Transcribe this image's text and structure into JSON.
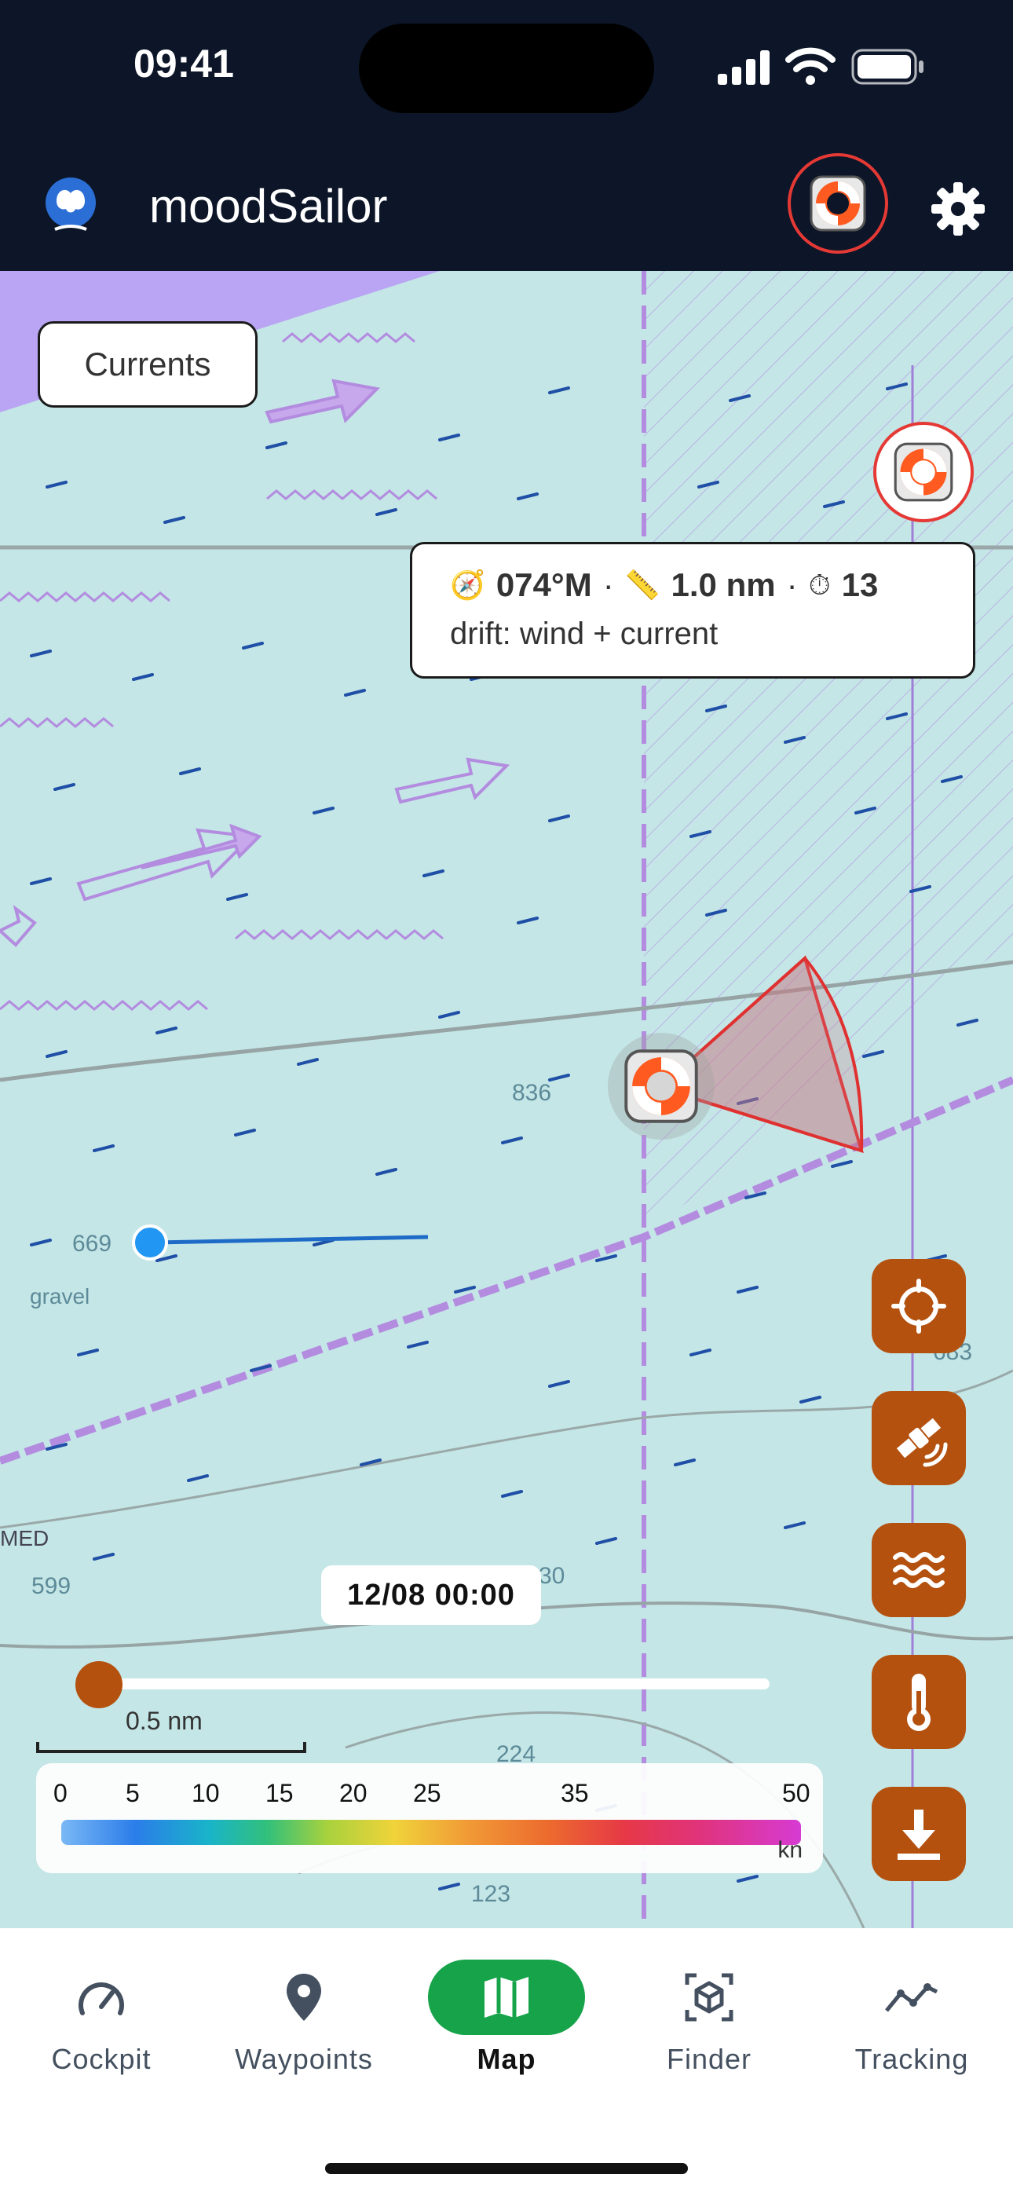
{
  "status_bar": {
    "time": "09:41"
  },
  "app": {
    "title": "moodSailor"
  },
  "map": {
    "currents_button": "Currents",
    "info_card": {
      "bearing": "074°M",
      "distance": "1.0 nm",
      "time": "13",
      "drift": "drift: wind + current"
    },
    "depth_labels": [
      "836",
      "669",
      "gravel",
      "683",
      "MED",
      "599",
      "30",
      "224",
      "123"
    ],
    "date_label": "12/08 00:00",
    "time_slider_position": 0,
    "scale_label": "0.5 nm",
    "legend": {
      "ticks": [
        "0",
        "5",
        "10",
        "15",
        "20",
        "25",
        "35",
        "50"
      ],
      "unit": "kn"
    }
  },
  "tabs": [
    {
      "label": "Cockpit",
      "icon": "gauge-icon",
      "active": false
    },
    {
      "label": "Waypoints",
      "icon": "map-pin-icon",
      "active": false
    },
    {
      "label": "Map",
      "icon": "map-icon",
      "active": true
    },
    {
      "label": "Finder",
      "icon": "cube-scan-icon",
      "active": false
    },
    {
      "label": "Tracking",
      "icon": "trend-line-icon",
      "active": false
    }
  ],
  "colors": {
    "accent": "#b4510f",
    "active_tab": "#16a34a",
    "sos": "#e53935",
    "header": "#0d1628"
  }
}
